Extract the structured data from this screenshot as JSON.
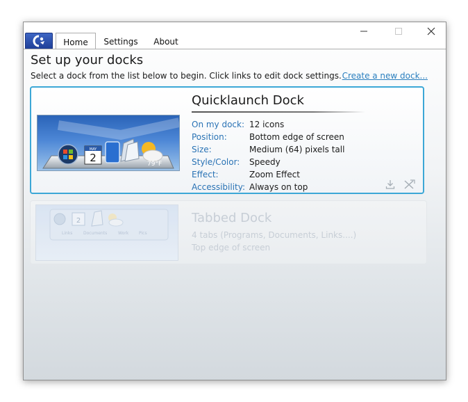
{
  "tabs": [
    {
      "label": "Home",
      "active": true
    },
    {
      "label": "Settings",
      "active": false
    },
    {
      "label": "About",
      "active": false
    }
  ],
  "header": {
    "title": "Set up your docks",
    "instructions": "Select a dock from the list below to begin. Click links to edit dock settings.",
    "create_link": "Create a new dock..."
  },
  "docks": [
    {
      "title": "Quicklaunch Dock",
      "selected": true,
      "properties": [
        {
          "label": "On my dock:",
          "value": "12 icons"
        },
        {
          "label": "Position:",
          "value": "Bottom edge of screen"
        },
        {
          "label": "Size:",
          "value": "Medium (64) pixels tall"
        },
        {
          "label": "Style/Color:",
          "value": "Speedy"
        },
        {
          "label": "Effect:",
          "value": "Zoom Effect"
        },
        {
          "label": "Accessibility:",
          "value": "Always on top"
        }
      ],
      "thumb": {
        "calendar_day": "2",
        "calendar_month": "MAY",
        "weather_temp": "79°F"
      }
    },
    {
      "title": "Tabbed Dock",
      "selected": false,
      "lines": [
        "4 tabs (Programs, Documents, Links....)",
        "Top edge of screen"
      ],
      "thumb": {
        "calendar_day": "2",
        "tab_labels": [
          "Links",
          "Documents",
          "Work",
          "Pics"
        ]
      }
    }
  ],
  "colors": {
    "selected_border": "#3ca7d6",
    "link": "#2a7fbf",
    "property_label": "#2a73b5"
  },
  "icons": {
    "app_menu": "rocketdock-logo-icon",
    "minimize": "minimize-icon",
    "maximize": "maximize-icon",
    "close": "close-icon",
    "save": "download-icon",
    "delete": "delete-icon"
  }
}
